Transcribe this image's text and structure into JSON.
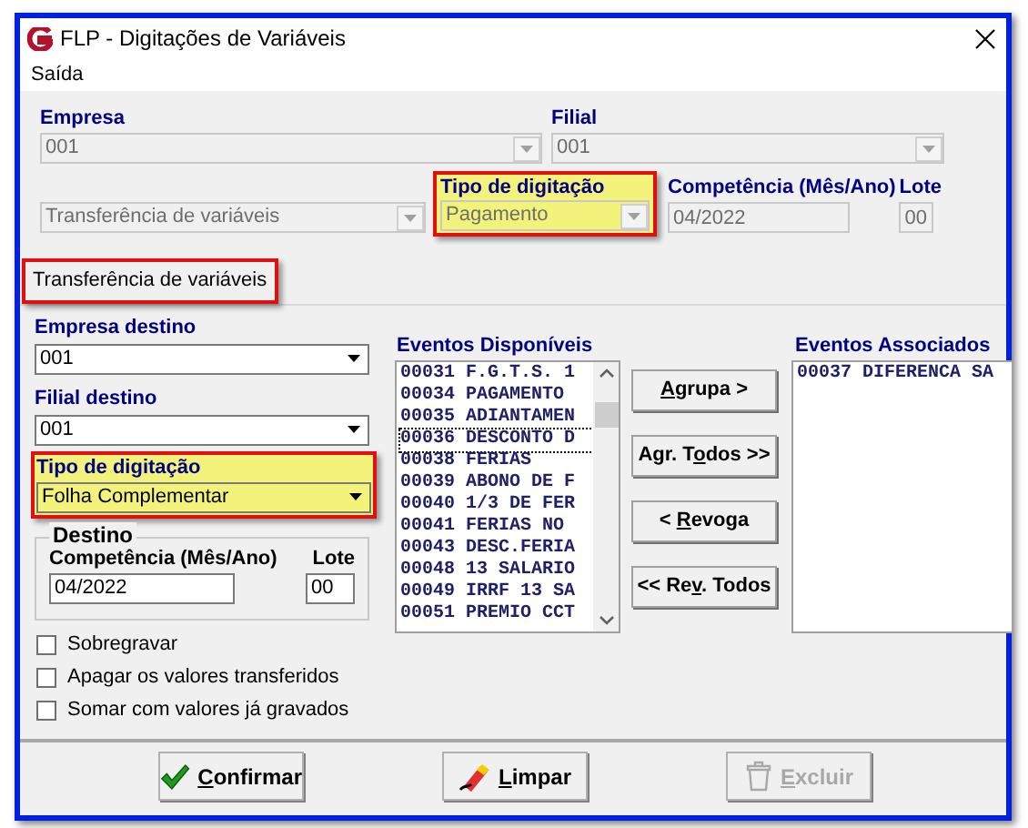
{
  "window": {
    "title": "FLP - Digitações de Variáveis"
  },
  "menu": [
    "Saída"
  ],
  "source": {
    "empresa": {
      "label": "Empresa",
      "value": "001",
      "disabled": true
    },
    "filial": {
      "label": "Filial",
      "value": "001",
      "disabled": true
    },
    "tipo_transferencia": {
      "value": "Transferência de variáveis",
      "disabled": true
    },
    "tipo_digitacao": {
      "label": "Tipo de digitação",
      "value": "Pagamento",
      "disabled": true,
      "highlighted": true
    },
    "competencia": {
      "label": "Competência (Mês/Ano)",
      "value": "04/2022",
      "disabled": true
    },
    "lote": {
      "label": "Lote",
      "value": "00",
      "disabled": true
    }
  },
  "section_tab": {
    "label": "Transferência de variáveis",
    "highlighted": true
  },
  "destination": {
    "empresa": {
      "label": "Empresa destino",
      "value": "001",
      "disabled": false
    },
    "filial": {
      "label": "Filial destino",
      "value": "001",
      "disabled": false
    },
    "tipo_digitacao": {
      "label": "Tipo de digitação",
      "value": "Folha Complementar",
      "disabled": false,
      "highlighted": true
    },
    "group": {
      "title": "Destino",
      "competencia": {
        "label": "Competência (Mês/Ano)",
        "value": "04/2022"
      },
      "lote": {
        "label": "Lote",
        "value": "00"
      }
    }
  },
  "options": [
    {
      "label": "Sobregravar",
      "checked": false
    },
    {
      "label": "Apagar os valores transferidos",
      "checked": false
    },
    {
      "label": "Somar com valores já gravados",
      "checked": false
    }
  ],
  "available_events": {
    "label": "Eventos Disponíveis",
    "items": [
      {
        "text": "00031 F.G.T.S. 1",
        "focused": false
      },
      {
        "text": "00034 PAGAMENTO",
        "focused": false
      },
      {
        "text": "00035 ADIANTAMEN",
        "focused": false
      },
      {
        "text": "00036 DESCONTO D",
        "focused": true
      },
      {
        "text": "00038 FERIAS",
        "focused": false
      },
      {
        "text": "00039 ABONO DE F",
        "focused": false
      },
      {
        "text": "00040 1/3 DE FER",
        "focused": false
      },
      {
        "text": "00041 FERIAS NO",
        "focused": false
      },
      {
        "text": "00043 DESC.FERIA",
        "focused": false
      },
      {
        "text": "00048 13 SALARIO",
        "focused": false
      },
      {
        "text": "00049 IRRF 13 SA",
        "focused": false
      },
      {
        "text": "00051 PREMIO CCT",
        "focused": false
      }
    ]
  },
  "transfer_buttons": [
    {
      "key": "A",
      "post": "grupa >"
    },
    {
      "pre": "Agr. T",
      "key": "o",
      "post": "dos >>"
    },
    {
      "pre": "< ",
      "key": "R",
      "post": "evoga"
    },
    {
      "pre": "<< Re",
      "key": "v",
      "post": ". Todos"
    }
  ],
  "associated_events": {
    "label": "Eventos Associados",
    "items": [
      {
        "text": "00037 DIFERENCA SA",
        "focused": false
      }
    ]
  },
  "footer_buttons": [
    {
      "kind": "confirm",
      "key": "C",
      "post": "onfirmar",
      "disabled": false
    },
    {
      "kind": "clear",
      "key": "L",
      "post": "impar",
      "disabled": false
    },
    {
      "kind": "delete",
      "key": "E",
      "post": "xcluir",
      "disabled": true
    }
  ]
}
